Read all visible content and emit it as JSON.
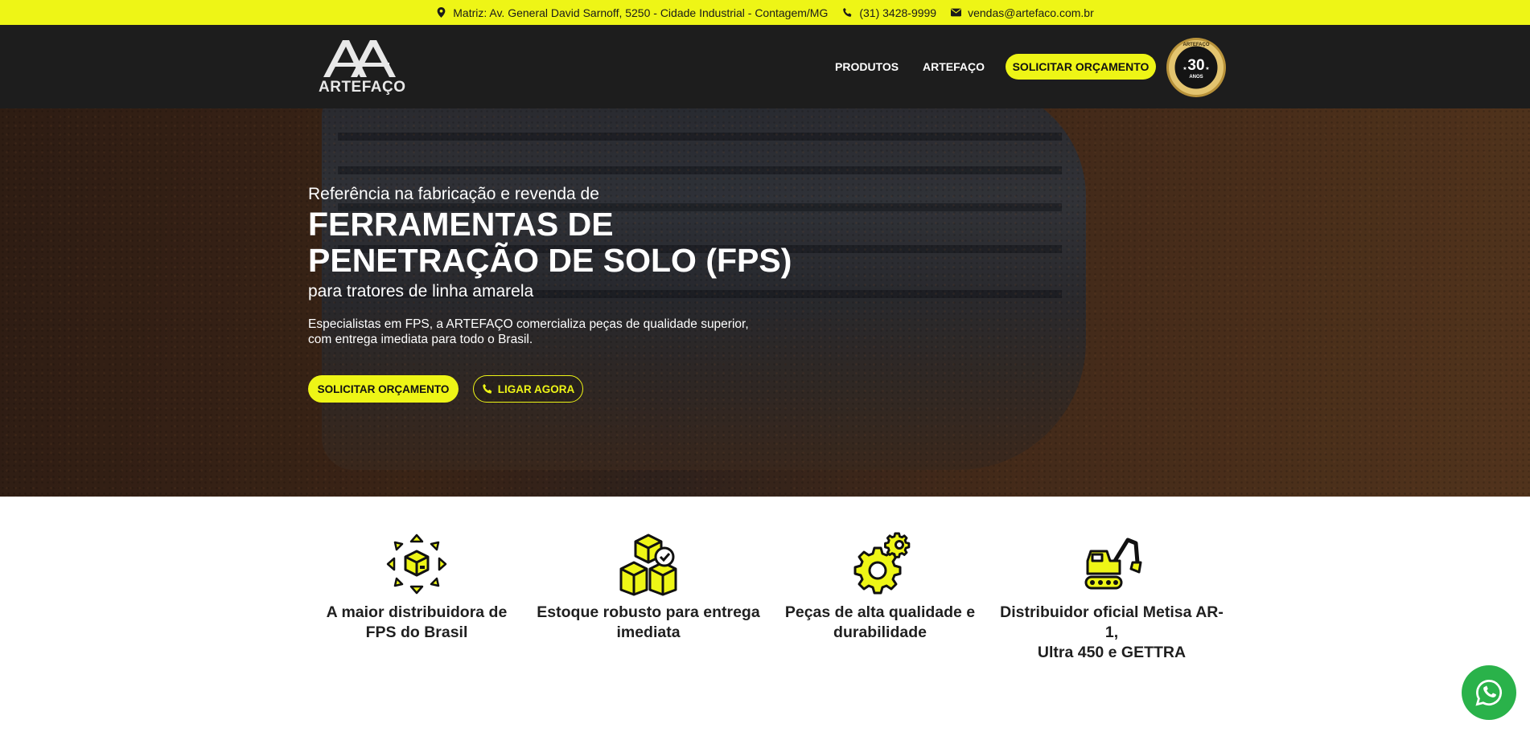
{
  "topbar": {
    "address": "Matriz: Av. General David Sarnoff, 5250 - Cidade Industrial - Contagem/MG",
    "phone": "(31) 3428-9999",
    "email": "vendas@artefaco.com.br"
  },
  "header": {
    "logo_text": "ARTEFAÇO",
    "nav": [
      {
        "label": "PRODUTOS"
      },
      {
        "label": "ARTEFAÇO"
      }
    ],
    "cta_label": "SOLICITAR ORÇAMENTO",
    "seal": {
      "brand": "ARTEFAÇO",
      "number": "30",
      "unit": "ANOS"
    }
  },
  "hero": {
    "pretitle": "Referência na fabricação e revenda de",
    "title_line1": "FERRAMENTAS DE",
    "title_line2": "PENETRAÇÃO DE SOLO (FPS)",
    "subtitle": "para tratores de linha amarela",
    "desc_line1": "Especialistas em FPS, a ARTEFAÇO comercializa peças de qualidade superior,",
    "desc_line2": "com entrega imediata para todo o Brasil.",
    "btn_quote": "SOLICITAR ORÇAMENTO",
    "btn_call": "LIGAR AGORA"
  },
  "features": [
    {
      "line1": "A maior distribuidora de",
      "line2": "FPS do Brasil",
      "icon": "box-arrows-icon"
    },
    {
      "line1": "Estoque robusto para entrega",
      "line2": "imediata",
      "icon": "stacked-boxes-icon"
    },
    {
      "line1": "Peças de alta qualidade e",
      "line2": "durabilidade",
      "icon": "gears-icon"
    },
    {
      "line1": "Distribuidor oficial Metisa AR-1,",
      "line2": "Ultra 450 e GETTRA",
      "icon": "excavator-icon"
    }
  ],
  "colors": {
    "accent": "#eef516",
    "header_bg": "#1d1d1d",
    "whatsapp": "#2ab24a"
  }
}
